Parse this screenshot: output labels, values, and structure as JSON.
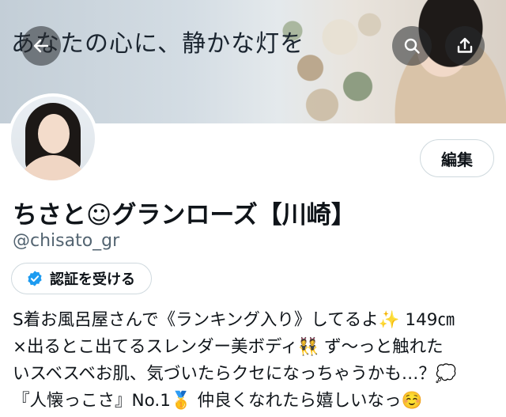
{
  "banner": {
    "text": "あなたの心に、静かな灯を"
  },
  "nav": {
    "back_icon": "arrow-left-icon",
    "search_icon": "search-icon",
    "share_icon": "share-icon"
  },
  "profile": {
    "edit_label": "編集",
    "display_name": "ちさと☺グランローズ【川崎】",
    "handle": "@chisato_gr",
    "verify_label": "認証を受ける",
    "verify_icon": "verified-badge-icon",
    "bio_lines": [
      "S着お風呂屋さんで《ランキング入り》してるよ✨ 149㎝",
      "×出るとこ出てるスレンダー美ボディ👯 ず〜っと触れた",
      "いスベスベお肌、気づいたらクセになっちゃうかも…？💭",
      "『人懐っこさ』No.1🥇 仲良くなれたら嬉しいなっ☺️"
    ]
  },
  "colors": {
    "accent": "#1d9bf0",
    "text": "#0f1419",
    "secondary_text": "#536471",
    "border": "#cfd9de"
  }
}
